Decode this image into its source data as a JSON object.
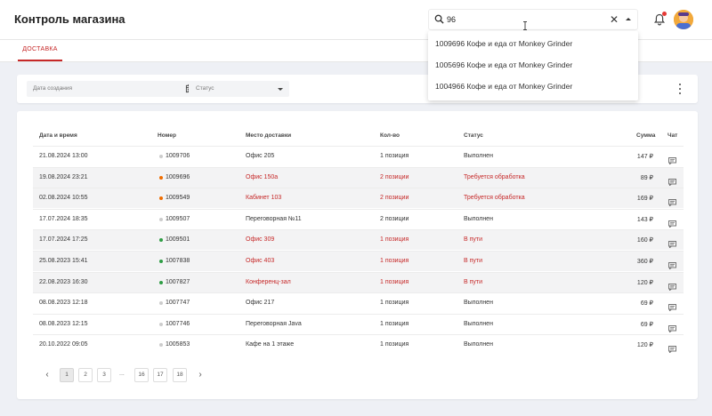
{
  "app": {
    "title": "Контроль магазина"
  },
  "tabs": [
    {
      "label": "ДОСТАВКА"
    }
  ],
  "search": {
    "value": "96"
  },
  "dropdown": {
    "items": [
      "1009696 Кофе и еда от Monkey Grinder",
      "1005696 Кофе и еда от Monkey Grinder",
      "1004966 Кофе и еда от Monkey Grinder"
    ]
  },
  "filters": {
    "date_placeholder": "Дата создания",
    "status_placeholder": "Статус"
  },
  "table": {
    "headers": {
      "datetime": "Дата и время",
      "number": "Номер",
      "place": "Место доставки",
      "qty": "Кол-во",
      "status": "Статус",
      "sum": "Сумма",
      "chat": "Чат"
    },
    "rows": [
      {
        "datetime": "21.08.2024 13:00",
        "number": "1009706",
        "place": "Офис 205",
        "qty": "1 позиция",
        "status": "Выполнен",
        "sum": "147 ₽",
        "dot": "#cccccc",
        "highlight": false,
        "alert": false
      },
      {
        "datetime": "19.08.2024 23:21",
        "number": "1009696",
        "place": "Офис 150а",
        "qty": "2 позиции",
        "status": "Требуется обработка",
        "sum": "89 ₽",
        "dot": "#ef6c00",
        "highlight": true,
        "alert": true
      },
      {
        "datetime": "02.08.2024 10:55",
        "number": "1009549",
        "place": "Кабинет 103",
        "qty": "2 позиции",
        "status": "Требуется обработка",
        "sum": "169 ₽",
        "dot": "#ef6c00",
        "highlight": true,
        "alert": true
      },
      {
        "datetime": "17.07.2024 18:35",
        "number": "1009507",
        "place": "Переговорная №11",
        "qty": "2 позиции",
        "status": "Выполнен",
        "sum": "143 ₽",
        "dot": "#cccccc",
        "highlight": false,
        "alert": false
      },
      {
        "datetime": "17.07.2024 17:25",
        "number": "1009501",
        "place": "Офис 309",
        "qty": "1 позиция",
        "status": "В пути",
        "sum": "160 ₽",
        "dot": "#2e9d44",
        "highlight": true,
        "alert": true
      },
      {
        "datetime": "25.08.2023 15:41",
        "number": "1007838",
        "place": "Офис 403",
        "qty": "1 позиция",
        "status": "В пути",
        "sum": "360 ₽",
        "dot": "#2e9d44",
        "highlight": true,
        "alert": true
      },
      {
        "datetime": "22.08.2023 16:30",
        "number": "1007827",
        "place": "Конференц-зал",
        "qty": "1 позиция",
        "status": "В пути",
        "sum": "120 ₽",
        "dot": "#2e9d44",
        "highlight": true,
        "alert": true
      },
      {
        "datetime": "08.08.2023 12:18",
        "number": "1007747",
        "place": "Офис 217",
        "qty": "1 позиция",
        "status": "Выполнен",
        "sum": "69 ₽",
        "dot": "#cccccc",
        "highlight": false,
        "alert": false
      },
      {
        "datetime": "08.08.2023 12:15",
        "number": "1007746",
        "place": "Переговорная Java",
        "qty": "1 позиция",
        "status": "Выполнен",
        "sum": "69 ₽",
        "dot": "#cccccc",
        "highlight": false,
        "alert": false
      },
      {
        "datetime": "20.10.2022 09:05",
        "number": "1005853",
        "place": "Кафе на 1 этаже",
        "qty": "1 позиция",
        "status": "Выполнен",
        "sum": "120 ₽",
        "dot": "#cccccc",
        "highlight": false,
        "alert": false
      }
    ]
  },
  "pagination": {
    "prev": "‹",
    "next": "›",
    "ellipsis": "...",
    "pages": [
      "1",
      "2",
      "3",
      "16",
      "17",
      "18"
    ],
    "current": "1"
  },
  "colors": {
    "accent": "#c62828",
    "in_progress": "#2e9d44",
    "needs_attention": "#ef6c00",
    "done": "#cccccc"
  }
}
